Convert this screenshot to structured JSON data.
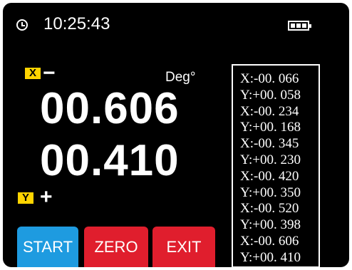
{
  "status_bar": {
    "time": "10:25:43",
    "clock_icon": "clock-icon",
    "battery_icon": "battery-full-icon",
    "battery_level": 1.0
  },
  "display": {
    "x_axis": {
      "tag": "X",
      "sign": "−",
      "value": "00.606"
    },
    "y_axis": {
      "tag": "Y",
      "sign": "+",
      "value": "00.410"
    },
    "unit": "Deg°"
  },
  "buttons": {
    "start": {
      "label": "START",
      "color": "#1e9be0"
    },
    "zero": {
      "label": "ZERO",
      "color": "#e01e2d"
    },
    "exit": {
      "label": "EXIT",
      "color": "#e01e2d"
    }
  },
  "log": [
    "X:-00. 066",
    "Y:+00. 058",
    "X:-00. 234",
    "Y:+00. 168",
    "X:-00. 345",
    "Y:+00. 230",
    "X:-00. 420",
    "Y:+00. 350",
    "X:-00. 520",
    "Y:+00. 398",
    "X:-00. 606",
    "Y:+00. 410"
  ],
  "colors": {
    "background": "#000000",
    "text": "#ffffff",
    "axis_tag": "#ffd400"
  }
}
